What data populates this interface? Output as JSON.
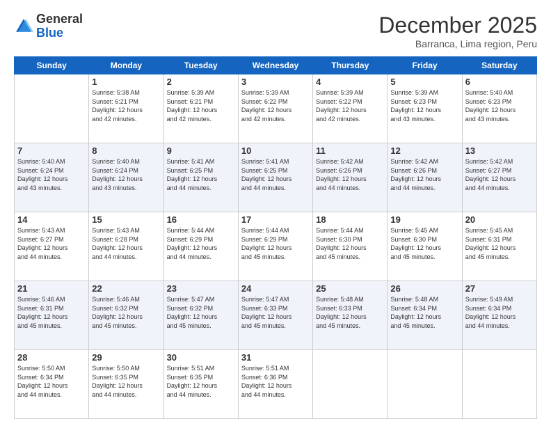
{
  "header": {
    "logo_general": "General",
    "logo_blue": "Blue",
    "month_title": "December 2025",
    "location": "Barranca, Lima region, Peru"
  },
  "days_of_week": [
    "Sunday",
    "Monday",
    "Tuesday",
    "Wednesday",
    "Thursday",
    "Friday",
    "Saturday"
  ],
  "weeks": [
    {
      "shaded": false,
      "cells": [
        {
          "day": "",
          "info": ""
        },
        {
          "day": "1",
          "info": "Sunrise: 5:38 AM\nSunset: 6:21 PM\nDaylight: 12 hours\nand 42 minutes."
        },
        {
          "day": "2",
          "info": "Sunrise: 5:39 AM\nSunset: 6:21 PM\nDaylight: 12 hours\nand 42 minutes."
        },
        {
          "day": "3",
          "info": "Sunrise: 5:39 AM\nSunset: 6:22 PM\nDaylight: 12 hours\nand 42 minutes."
        },
        {
          "day": "4",
          "info": "Sunrise: 5:39 AM\nSunset: 6:22 PM\nDaylight: 12 hours\nand 42 minutes."
        },
        {
          "day": "5",
          "info": "Sunrise: 5:39 AM\nSunset: 6:23 PM\nDaylight: 12 hours\nand 43 minutes."
        },
        {
          "day": "6",
          "info": "Sunrise: 5:40 AM\nSunset: 6:23 PM\nDaylight: 12 hours\nand 43 minutes."
        }
      ]
    },
    {
      "shaded": true,
      "cells": [
        {
          "day": "7",
          "info": "Sunrise: 5:40 AM\nSunset: 6:24 PM\nDaylight: 12 hours\nand 43 minutes."
        },
        {
          "day": "8",
          "info": "Sunrise: 5:40 AM\nSunset: 6:24 PM\nDaylight: 12 hours\nand 43 minutes."
        },
        {
          "day": "9",
          "info": "Sunrise: 5:41 AM\nSunset: 6:25 PM\nDaylight: 12 hours\nand 44 minutes."
        },
        {
          "day": "10",
          "info": "Sunrise: 5:41 AM\nSunset: 6:25 PM\nDaylight: 12 hours\nand 44 minutes."
        },
        {
          "day": "11",
          "info": "Sunrise: 5:42 AM\nSunset: 6:26 PM\nDaylight: 12 hours\nand 44 minutes."
        },
        {
          "day": "12",
          "info": "Sunrise: 5:42 AM\nSunset: 6:26 PM\nDaylight: 12 hours\nand 44 minutes."
        },
        {
          "day": "13",
          "info": "Sunrise: 5:42 AM\nSunset: 6:27 PM\nDaylight: 12 hours\nand 44 minutes."
        }
      ]
    },
    {
      "shaded": false,
      "cells": [
        {
          "day": "14",
          "info": "Sunrise: 5:43 AM\nSunset: 6:27 PM\nDaylight: 12 hours\nand 44 minutes."
        },
        {
          "day": "15",
          "info": "Sunrise: 5:43 AM\nSunset: 6:28 PM\nDaylight: 12 hours\nand 44 minutes."
        },
        {
          "day": "16",
          "info": "Sunrise: 5:44 AM\nSunset: 6:29 PM\nDaylight: 12 hours\nand 44 minutes."
        },
        {
          "day": "17",
          "info": "Sunrise: 5:44 AM\nSunset: 6:29 PM\nDaylight: 12 hours\nand 45 minutes."
        },
        {
          "day": "18",
          "info": "Sunrise: 5:44 AM\nSunset: 6:30 PM\nDaylight: 12 hours\nand 45 minutes."
        },
        {
          "day": "19",
          "info": "Sunrise: 5:45 AM\nSunset: 6:30 PM\nDaylight: 12 hours\nand 45 minutes."
        },
        {
          "day": "20",
          "info": "Sunrise: 5:45 AM\nSunset: 6:31 PM\nDaylight: 12 hours\nand 45 minutes."
        }
      ]
    },
    {
      "shaded": true,
      "cells": [
        {
          "day": "21",
          "info": "Sunrise: 5:46 AM\nSunset: 6:31 PM\nDaylight: 12 hours\nand 45 minutes."
        },
        {
          "day": "22",
          "info": "Sunrise: 5:46 AM\nSunset: 6:32 PM\nDaylight: 12 hours\nand 45 minutes."
        },
        {
          "day": "23",
          "info": "Sunrise: 5:47 AM\nSunset: 6:32 PM\nDaylight: 12 hours\nand 45 minutes."
        },
        {
          "day": "24",
          "info": "Sunrise: 5:47 AM\nSunset: 6:33 PM\nDaylight: 12 hours\nand 45 minutes."
        },
        {
          "day": "25",
          "info": "Sunrise: 5:48 AM\nSunset: 6:33 PM\nDaylight: 12 hours\nand 45 minutes."
        },
        {
          "day": "26",
          "info": "Sunrise: 5:48 AM\nSunset: 6:34 PM\nDaylight: 12 hours\nand 45 minutes."
        },
        {
          "day": "27",
          "info": "Sunrise: 5:49 AM\nSunset: 6:34 PM\nDaylight: 12 hours\nand 44 minutes."
        }
      ]
    },
    {
      "shaded": false,
      "cells": [
        {
          "day": "28",
          "info": "Sunrise: 5:50 AM\nSunset: 6:34 PM\nDaylight: 12 hours\nand 44 minutes."
        },
        {
          "day": "29",
          "info": "Sunrise: 5:50 AM\nSunset: 6:35 PM\nDaylight: 12 hours\nand 44 minutes."
        },
        {
          "day": "30",
          "info": "Sunrise: 5:51 AM\nSunset: 6:35 PM\nDaylight: 12 hours\nand 44 minutes."
        },
        {
          "day": "31",
          "info": "Sunrise: 5:51 AM\nSunset: 6:36 PM\nDaylight: 12 hours\nand 44 minutes."
        },
        {
          "day": "",
          "info": ""
        },
        {
          "day": "",
          "info": ""
        },
        {
          "day": "",
          "info": ""
        }
      ]
    }
  ]
}
